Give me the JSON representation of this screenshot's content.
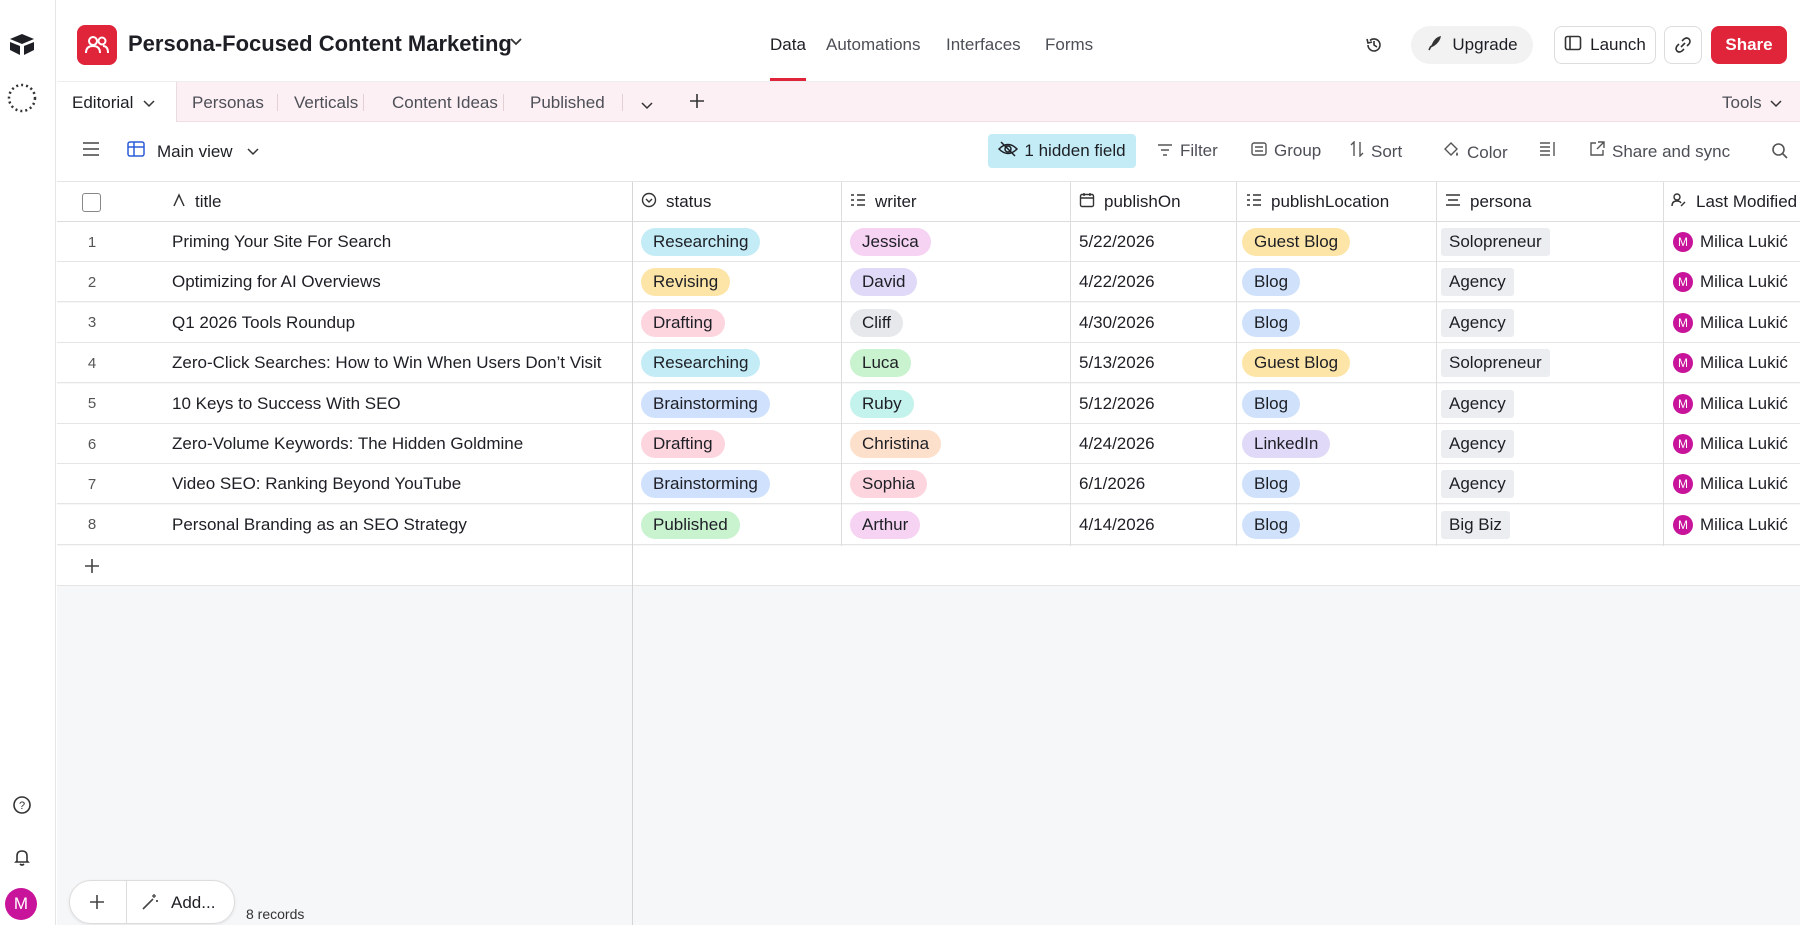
{
  "app": {
    "base_title": "Persona-Focused Content Marketing",
    "avatar_letter": "M",
    "colors": {
      "brand": "#e0243a",
      "accent_blue": "#c4ecf6",
      "tabs_bg": "#fdf0f4"
    }
  },
  "nav": {
    "tabs": [
      "Data",
      "Automations",
      "Interfaces",
      "Forms"
    ],
    "active": "Data"
  },
  "toolbar": {
    "upgrade_label": "Upgrade",
    "launch_label": "Launch",
    "share_label": "Share"
  },
  "tables": {
    "active": "Editorial",
    "others": [
      "Personas",
      "Verticals",
      "Content Ideas",
      "Published"
    ],
    "tools_label": "Tools"
  },
  "view": {
    "name": "Main view",
    "hidden_fields": "1 hidden field",
    "filter": "Filter",
    "group": "Group",
    "sort": "Sort",
    "color": "Color",
    "share_sync": "Share and sync"
  },
  "grid": {
    "columns": [
      "title",
      "status",
      "writer",
      "publishOn",
      "publishLocation",
      "persona",
      "Last Modified"
    ],
    "rows": [
      {
        "n": "1",
        "title": "Priming Your Site For Search",
        "status": "Researching",
        "writer": "Jessica",
        "publishOn": "5/22/2026",
        "publishLocation": "Guest Blog",
        "persona": "Solopreneur",
        "modified": "Milica Lukić"
      },
      {
        "n": "2",
        "title": "Optimizing for AI Overviews",
        "status": "Revising",
        "writer": "David",
        "publishOn": "4/22/2026",
        "publishLocation": "Blog",
        "persona": "Agency",
        "modified": "Milica Lukić"
      },
      {
        "n": "3",
        "title": "Q1 2026 Tools Roundup",
        "status": "Drafting",
        "writer": "Cliff",
        "publishOn": "4/30/2026",
        "publishLocation": "Blog",
        "persona": "Agency",
        "modified": "Milica Lukić"
      },
      {
        "n": "4",
        "title": "Zero-Click Searches: How to Win When Users Don’t Visit",
        "status": "Researching",
        "writer": "Luca",
        "publishOn": "5/13/2026",
        "publishLocation": "Guest Blog",
        "persona": "Solopreneur",
        "modified": "Milica Lukić"
      },
      {
        "n": "5",
        "title": "10 Keys to Success With SEO",
        "status": "Brainstorming",
        "writer": "Ruby",
        "publishOn": "5/12/2026",
        "publishLocation": "Blog",
        "persona": "Agency",
        "modified": "Milica Lukić"
      },
      {
        "n": "6",
        "title": "Zero-Volume Keywords: The Hidden Goldmine",
        "status": "Drafting",
        "writer": "Christina",
        "publishOn": "4/24/2026",
        "publishLocation": "LinkedIn",
        "persona": "Agency",
        "modified": "Milica Lukić"
      },
      {
        "n": "7",
        "title": "Video SEO: Ranking Beyond YouTube",
        "status": "Brainstorming",
        "writer": "Sophia",
        "publishOn": "6/1/2026",
        "publishLocation": "Blog",
        "persona": "Agency",
        "modified": "Milica Lukić"
      },
      {
        "n": "8",
        "title": "Personal Branding as an SEO Strategy",
        "status": "Published",
        "writer": "Arthur",
        "publishOn": "4/14/2026",
        "publishLocation": "Blog",
        "persona": "Big Biz",
        "modified": "Milica Lukić"
      }
    ],
    "status_colors": {
      "Researching": "#c4ecf6",
      "Revising": "#fde5a8",
      "Drafting": "#fdd5df",
      "Brainstorming": "#cfe1fc",
      "Published": "#c9f2cf"
    },
    "writer_colors": {
      "Jessica": "#f6d2f3",
      "David": "#e0d9f7",
      "Cliff": "#e6e8ec",
      "Luca": "#c9f2cf",
      "Ruby": "#c4f2ec",
      "Christina": "#fde0cc",
      "Sophia": "#fdd5df",
      "Arthur": "#f6d2f3"
    },
    "location_colors": {
      "Guest Blog": "#fde5a8",
      "Blog": "#d0e2fb",
      "LinkedIn": "#e0d9f7"
    }
  },
  "footer": {
    "add_label": "Add...",
    "record_count": "8 records"
  }
}
